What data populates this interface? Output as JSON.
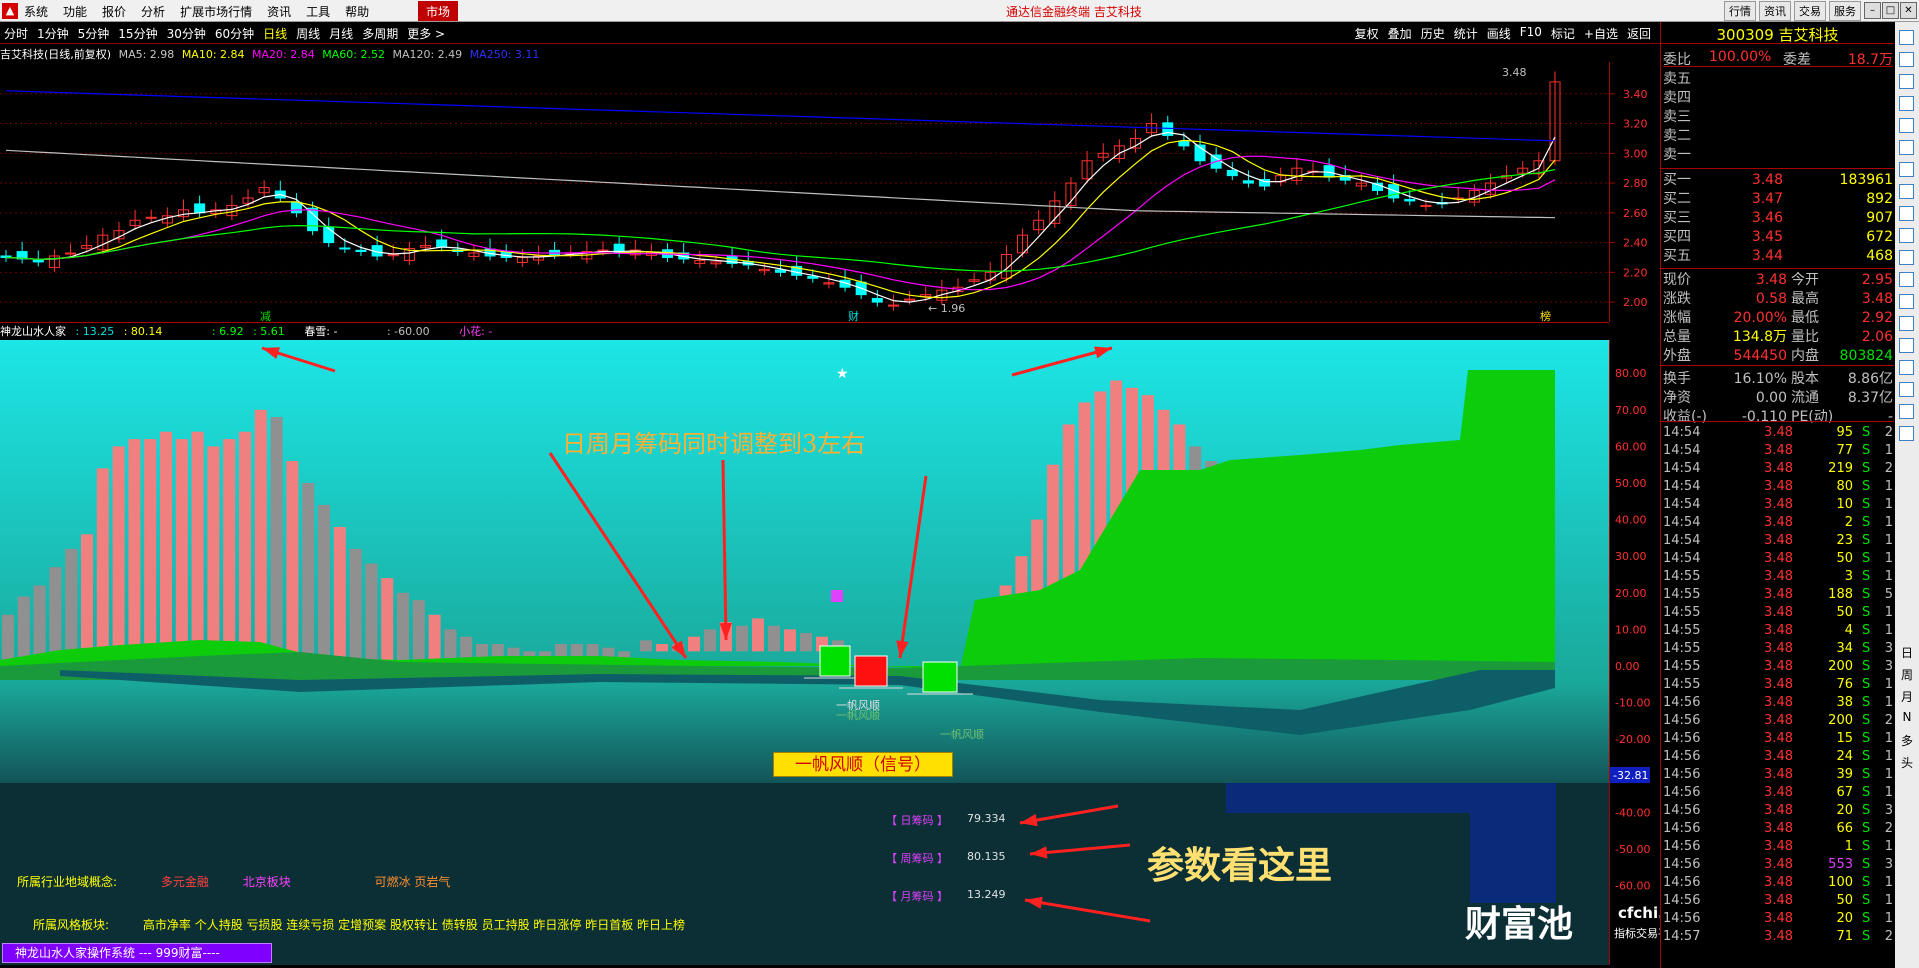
{
  "app": {
    "title": "通达信金融终端 吉艾科技",
    "market_tab": "市场",
    "menu": [
      "系统",
      "功能",
      "报价",
      "分析",
      "扩展市场行情",
      "资讯",
      "工具",
      "帮助"
    ],
    "right_buttons": [
      "行情",
      "资讯",
      "交易",
      "服务"
    ]
  },
  "periods": [
    "分时",
    "1分钟",
    "5分钟",
    "15分钟",
    "30分钟",
    "60分钟",
    "日线",
    "周线",
    "月线",
    "多周期",
    "更多 >"
  ],
  "active_period": "日线",
  "chart_tools": [
    "复权",
    "叠加",
    "历史",
    "统计",
    "画线",
    "F10",
    "标记",
    "+自选",
    "返回"
  ],
  "kline_info": {
    "name": "吉艾科技(日线,前复权)",
    "ma5": "MA5: 2.98",
    "ma10": "MA10: 2.84",
    "ma20": "MA20: 2.84",
    "ma60": "MA60: 2.52",
    "ma120": "MA120: 2.49",
    "ma250": "MA250: 3.11"
  },
  "kline_axis": [
    "3.40",
    "3.20",
    "3.00",
    "2.80",
    "2.60",
    "2.40",
    "2.20",
    "2.00"
  ],
  "kline_labels": {
    "high": "3.48",
    "low": "1.96",
    "mark1": "减",
    "mark2": "财",
    "mark3": "榜"
  },
  "kline_colors": {
    "up": "#ff3030",
    "down": "#00ffff",
    "ma5": "#ffffff",
    "ma10": "#ffff00",
    "ma20": "#ff00ff",
    "ma60": "#00ff00",
    "ma120": "#c0c0c0",
    "ma250": "#0000ff"
  },
  "indicator_info": {
    "name": "神龙山水人家",
    "v1": ": 13.25",
    "v2": ": 80.14",
    "v3": ": 6.92",
    "v4": ": 5.61",
    "name2": "春雪: -",
    "v5": ": -60.00",
    "name3": "小花: -"
  },
  "indicator_axis": [
    "80.00",
    "70.00",
    "60.00",
    "50.00",
    "40.00",
    "30.00",
    "20.00",
    "10.00",
    "0.00",
    "-10.00",
    "-20.00",
    "-30.00",
    "-40.00",
    "-50.00",
    "-60.00"
  ],
  "indicator_cursor": "-32.81",
  "annotations": {
    "top_text": "日周月筹码同时调整到3左右",
    "signal": "一帆风顺（信号）",
    "yifan1": "一帆风顺",
    "yifan2": "一帆风顺",
    "yifan3": "一帆风顺",
    "param_text": "参数看这里"
  },
  "chips": [
    {
      "label": "【 日筹码 】",
      "value": "79.334"
    },
    {
      "label": "【 周筹码 】",
      "value": "80.135"
    },
    {
      "label": "【 月筹码 】",
      "value": "13.249"
    }
  ],
  "concept": {
    "label": "所属行业地域概念:",
    "items": [
      "多元金融",
      "北京板块",
      "可燃冰 页岩气"
    ]
  },
  "style": {
    "label": "所属风格板块:",
    "items": "高市净率 个人持股 亏损股 连续亏损 定增预案 股权转让 债转股 员工持股 昨日涨停 昨日首板 昨日上榜"
  },
  "system_label": "神龙山水人家操作系统 --- 999财富----",
  "watermark": {
    "brand": "财富池",
    "site": "cfchi.com",
    "sub": "指标交易平台"
  },
  "quote": {
    "code_name": "300309 吉艾科技",
    "weibi": {
      "label": "委比",
      "value": "100.00%",
      "label2": "委差",
      "value2": "18.7万"
    },
    "sells": [
      "卖五",
      "卖四",
      "卖三",
      "卖二",
      "卖一"
    ],
    "buys": [
      {
        "label": "买一",
        "price": "3.48",
        "vol": "183961"
      },
      {
        "label": "买二",
        "price": "3.47",
        "vol": "892"
      },
      {
        "label": "买三",
        "price": "3.46",
        "vol": "907"
      },
      {
        "label": "买四",
        "price": "3.45",
        "vol": "672"
      },
      {
        "label": "买五",
        "price": "3.44",
        "vol": "468"
      }
    ],
    "stats": [
      {
        "l1": "现价",
        "v1": "3.48",
        "l2": "今开",
        "v2": "2.95"
      },
      {
        "l1": "涨跌",
        "v1": "0.58",
        "l2": "最高",
        "v2": "3.48"
      },
      {
        "l1": "涨幅",
        "v1": "20.00%",
        "l2": "最低",
        "v2": "2.92"
      },
      {
        "l1": "总量",
        "v1": "134.8万",
        "l2": "量比",
        "v2": "2.06"
      },
      {
        "l1": "外盘",
        "v1": "544450",
        "l2": "内盘",
        "v2": "803824"
      },
      {
        "l1": "换手",
        "v1": "16.10%",
        "l2": "股本",
        "v2": "8.86亿"
      },
      {
        "l1": "净资",
        "v1": "0.00",
        "l2": "流通",
        "v2": "8.37亿"
      },
      {
        "l1": "收益(-)",
        "v1": "-0.110",
        "l2": "PE(动)",
        "v2": "-"
      }
    ]
  },
  "ticks": [
    {
      "t": "14:54",
      "p": "3.48",
      "v": "95",
      "s": "S",
      "n": "2"
    },
    {
      "t": "14:54",
      "p": "3.48",
      "v": "77",
      "s": "S",
      "n": "1"
    },
    {
      "t": "14:54",
      "p": "3.48",
      "v": "219",
      "s": "S",
      "n": "2"
    },
    {
      "t": "14:54",
      "p": "3.48",
      "v": "80",
      "s": "S",
      "n": "1"
    },
    {
      "t": "14:54",
      "p": "3.48",
      "v": "10",
      "s": "S",
      "n": "1"
    },
    {
      "t": "14:54",
      "p": "3.48",
      "v": "2",
      "s": "S",
      "n": "1"
    },
    {
      "t": "14:54",
      "p": "3.48",
      "v": "23",
      "s": "S",
      "n": "1"
    },
    {
      "t": "14:54",
      "p": "3.48",
      "v": "50",
      "s": "S",
      "n": "1"
    },
    {
      "t": "14:55",
      "p": "3.48",
      "v": "3",
      "s": "S",
      "n": "1"
    },
    {
      "t": "14:55",
      "p": "3.48",
      "v": "188",
      "s": "S",
      "n": "5"
    },
    {
      "t": "14:55",
      "p": "3.48",
      "v": "50",
      "s": "S",
      "n": "1"
    },
    {
      "t": "14:55",
      "p": "3.48",
      "v": "4",
      "s": "S",
      "n": "1"
    },
    {
      "t": "14:55",
      "p": "3.48",
      "v": "34",
      "s": "S",
      "n": "3"
    },
    {
      "t": "14:55",
      "p": "3.48",
      "v": "200",
      "s": "S",
      "n": "3"
    },
    {
      "t": "14:55",
      "p": "3.48",
      "v": "76",
      "s": "S",
      "n": "1"
    },
    {
      "t": "14:56",
      "p": "3.48",
      "v": "38",
      "s": "S",
      "n": "1"
    },
    {
      "t": "14:56",
      "p": "3.48",
      "v": "200",
      "s": "S",
      "n": "2"
    },
    {
      "t": "14:56",
      "p": "3.48",
      "v": "15",
      "s": "S",
      "n": "1"
    },
    {
      "t": "14:56",
      "p": "3.48",
      "v": "24",
      "s": "S",
      "n": "1"
    },
    {
      "t": "14:56",
      "p": "3.48",
      "v": "39",
      "s": "S",
      "n": "1"
    },
    {
      "t": "14:56",
      "p": "3.48",
      "v": "67",
      "s": "S",
      "n": "1"
    },
    {
      "t": "14:56",
      "p": "3.48",
      "v": "20",
      "s": "S",
      "n": "3"
    },
    {
      "t": "14:56",
      "p": "3.48",
      "v": "66",
      "s": "S",
      "n": "2"
    },
    {
      "t": "14:56",
      "p": "3.48",
      "v": "1",
      "s": "S",
      "n": "1"
    },
    {
      "t": "14:56",
      "p": "3.48",
      "v": "553",
      "s": "S",
      "n": "3"
    },
    {
      "t": "14:56",
      "p": "3.48",
      "v": "100",
      "s": "S",
      "n": "1"
    },
    {
      "t": "14:56",
      "p": "3.48",
      "v": "50",
      "s": "S",
      "n": "1"
    },
    {
      "t": "14:56",
      "p": "3.48",
      "v": "20",
      "s": "S",
      "n": "1"
    },
    {
      "t": "14:57",
      "p": "3.48",
      "v": "71",
      "s": "S",
      "n": "2"
    }
  ],
  "side_tools": [
    "日",
    "周",
    "月",
    "N",
    "多",
    "头"
  ]
}
